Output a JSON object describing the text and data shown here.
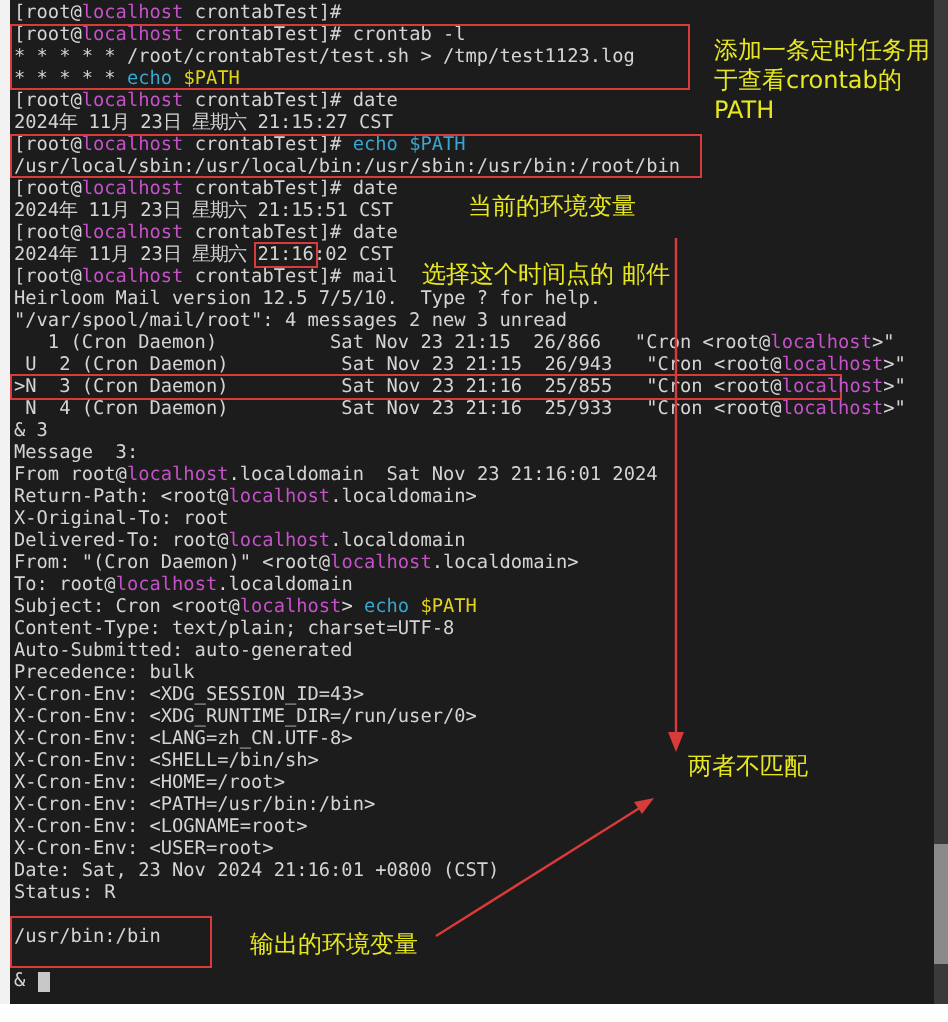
{
  "terminal": {
    "lines": [
      {
        "kind": "text",
        "segments": [
          {
            "text": "[root@",
            "kind": "plain"
          },
          {
            "text": "localhost",
            "kind": "host"
          },
          {
            "text": " crontabTest]#",
            "kind": "plain"
          }
        ]
      },
      {
        "kind": "text",
        "segments": [
          {
            "text": "[root@",
            "kind": "plain"
          },
          {
            "text": "localhost",
            "kind": "host"
          },
          {
            "text": " crontabTest]# crontab -l",
            "kind": "plain"
          }
        ]
      },
      {
        "kind": "text",
        "segments": [
          {
            "text": "* * * * * /root/crontabTest/test.sh > /tmp/test1123.log",
            "kind": "plain"
          }
        ]
      },
      {
        "kind": "text",
        "segments": [
          {
            "text": "* * * * * ",
            "kind": "plain"
          },
          {
            "text": "echo ",
            "kind": "cmd"
          },
          {
            "text": "$PATH",
            "kind": "var"
          }
        ]
      },
      {
        "kind": "text",
        "segments": [
          {
            "text": "[root@",
            "kind": "plain"
          },
          {
            "text": "localhost",
            "kind": "host"
          },
          {
            "text": " crontabTest]# date",
            "kind": "plain"
          }
        ]
      },
      {
        "kind": "text",
        "segments": [
          {
            "text": "2024年 11月 23日 星期六 21:15:27 CST",
            "kind": "plain"
          }
        ]
      },
      {
        "kind": "text",
        "segments": [
          {
            "text": "[root@",
            "kind": "plain"
          },
          {
            "text": "localhost",
            "kind": "host"
          },
          {
            "text": " crontabTest]# ",
            "kind": "plain"
          },
          {
            "text": "echo ",
            "kind": "cmd"
          },
          {
            "text": "$PATH",
            "kind": "cmd"
          }
        ]
      },
      {
        "kind": "text",
        "segments": [
          {
            "text": "/usr/local/sbin:/usr/local/bin:/usr/sbin:/usr/bin:/root/bin",
            "kind": "plain"
          }
        ]
      },
      {
        "kind": "text",
        "segments": [
          {
            "text": "[root@",
            "kind": "plain"
          },
          {
            "text": "localhost",
            "kind": "host"
          },
          {
            "text": " crontabTest]# date",
            "kind": "plain"
          }
        ]
      },
      {
        "kind": "text",
        "segments": [
          {
            "text": "2024年 11月 23日 星期六 21:15:51 CST",
            "kind": "plain"
          }
        ]
      },
      {
        "kind": "text",
        "segments": [
          {
            "text": "[root@",
            "kind": "plain"
          },
          {
            "text": "localhost",
            "kind": "host"
          },
          {
            "text": " crontabTest]# date",
            "kind": "plain"
          }
        ]
      },
      {
        "kind": "text",
        "segments": [
          {
            "text": "2024年 11月 23日 星期六 ",
            "kind": "plain"
          },
          {
            "text": "21:16",
            "kind": "plain"
          },
          {
            "text": ":02 CST",
            "kind": "plain"
          }
        ]
      },
      {
        "kind": "text",
        "segments": [
          {
            "text": "[root@",
            "kind": "plain"
          },
          {
            "text": "localhost",
            "kind": "host"
          },
          {
            "text": " crontabTest]# mail",
            "kind": "plain"
          }
        ]
      },
      {
        "kind": "text",
        "segments": [
          {
            "text": "Heirloom Mail version 12.5 7/5/10.  Type ? for help.",
            "kind": "plain"
          }
        ]
      },
      {
        "kind": "text",
        "segments": [
          {
            "text": "\"/var/spool/mail/root\": 4 messages 2 new 3 unread",
            "kind": "plain"
          }
        ]
      },
      {
        "kind": "text",
        "segments": [
          {
            "text": "   1 (Cron Daemon)          Sat Nov 23 21:15  26/866   \"Cron <root@",
            "kind": "plain"
          },
          {
            "text": "localhost",
            "kind": "host"
          },
          {
            "text": ">\"",
            "kind": "plain"
          }
        ]
      },
      {
        "kind": "text",
        "segments": [
          {
            "text": " U  2 (Cron Daemon)          Sat Nov 23 21:15  26/943   \"Cron <root@",
            "kind": "plain"
          },
          {
            "text": "localhost",
            "kind": "host"
          },
          {
            "text": ">\"",
            "kind": "plain"
          }
        ]
      },
      {
        "kind": "text",
        "segments": [
          {
            "text": ">N  3 (Cron Daemon)          Sat Nov 23 21:16  25/855   \"Cron <root@",
            "kind": "plain"
          },
          {
            "text": "local",
            "kind": "host"
          },
          {
            "text": "host",
            "kind": "host"
          },
          {
            "text": ">\"",
            "kind": "plain"
          }
        ]
      },
      {
        "kind": "text",
        "segments": [
          {
            "text": " N  4 (Cron Daemon)          Sat Nov 23 21:16  25/933   \"Cron <root@",
            "kind": "plain"
          },
          {
            "text": "localhost",
            "kind": "host"
          },
          {
            "text": ">\"",
            "kind": "plain"
          }
        ]
      },
      {
        "kind": "text",
        "segments": [
          {
            "text": "& 3",
            "kind": "plain"
          }
        ]
      },
      {
        "kind": "text",
        "segments": [
          {
            "text": "Message  3:",
            "kind": "plain"
          }
        ]
      },
      {
        "kind": "text",
        "segments": [
          {
            "text": "From root@",
            "kind": "plain"
          },
          {
            "text": "localhost",
            "kind": "host"
          },
          {
            "text": ".localdomain  Sat Nov 23 21:16:01 2024",
            "kind": "plain"
          }
        ]
      },
      {
        "kind": "text",
        "segments": [
          {
            "text": "Return-Path: <root@",
            "kind": "plain"
          },
          {
            "text": "localhost",
            "kind": "host"
          },
          {
            "text": ".localdomain>",
            "kind": "plain"
          }
        ]
      },
      {
        "kind": "text",
        "segments": [
          {
            "text": "X-Original-To: root",
            "kind": "plain"
          }
        ]
      },
      {
        "kind": "text",
        "segments": [
          {
            "text": "Delivered-To: root@",
            "kind": "plain"
          },
          {
            "text": "localhost",
            "kind": "host"
          },
          {
            "text": ".localdomain",
            "kind": "plain"
          }
        ]
      },
      {
        "kind": "text",
        "segments": [
          {
            "text": "From: \"(Cron Daemon)\" <root@",
            "kind": "plain"
          },
          {
            "text": "localhost",
            "kind": "host"
          },
          {
            "text": ".localdomain>",
            "kind": "plain"
          }
        ]
      },
      {
        "kind": "text",
        "segments": [
          {
            "text": "To: root@",
            "kind": "plain"
          },
          {
            "text": "localhost",
            "kind": "host"
          },
          {
            "text": ".localdomain",
            "kind": "plain"
          }
        ]
      },
      {
        "kind": "text",
        "segments": [
          {
            "text": "Subject: Cron <root@",
            "kind": "plain"
          },
          {
            "text": "localhost",
            "kind": "host"
          },
          {
            "text": "> ",
            "kind": "plain"
          },
          {
            "text": "echo ",
            "kind": "cmd"
          },
          {
            "text": "$PATH",
            "kind": "var"
          }
        ]
      },
      {
        "kind": "text",
        "segments": [
          {
            "text": "Content-Type: text/plain; charset=UTF-8",
            "kind": "plain"
          }
        ]
      },
      {
        "kind": "text",
        "segments": [
          {
            "text": "Auto-Submitted: auto-generated",
            "kind": "plain"
          }
        ]
      },
      {
        "kind": "text",
        "segments": [
          {
            "text": "Precedence: bulk",
            "kind": "plain"
          }
        ]
      },
      {
        "kind": "text",
        "segments": [
          {
            "text": "X-Cron-Env: <XDG_SESSION_ID=43>",
            "kind": "plain"
          }
        ]
      },
      {
        "kind": "text",
        "segments": [
          {
            "text": "X-Cron-Env: <XDG_RUNTIME_DIR=/run/user/0>",
            "kind": "plain"
          }
        ]
      },
      {
        "kind": "text",
        "segments": [
          {
            "text": "X-Cron-Env: <LANG=zh_CN.UTF-8>",
            "kind": "plain"
          }
        ]
      },
      {
        "kind": "text",
        "segments": [
          {
            "text": "X-Cron-Env: <SHELL=/bin/sh>",
            "kind": "plain"
          }
        ]
      },
      {
        "kind": "text",
        "segments": [
          {
            "text": "X-Cron-Env: <HOME=/root>",
            "kind": "plain"
          }
        ]
      },
      {
        "kind": "text",
        "segments": [
          {
            "text": "X-Cron-Env: <PATH=/usr/bin:/bin>",
            "kind": "plain"
          }
        ]
      },
      {
        "kind": "text",
        "segments": [
          {
            "text": "X-Cron-Env: <LOGNAME=root>",
            "kind": "plain"
          }
        ]
      },
      {
        "kind": "text",
        "segments": [
          {
            "text": "X-Cron-Env: <USER=root>",
            "kind": "plain"
          }
        ]
      },
      {
        "kind": "text",
        "segments": [
          {
            "text": "Date: Sat, 23 Nov 2024 21:16:01 +0800 (CST)",
            "kind": "plain"
          }
        ]
      },
      {
        "kind": "text",
        "segments": [
          {
            "text": "Status: R",
            "kind": "plain"
          }
        ]
      },
      {
        "kind": "blank"
      },
      {
        "kind": "text",
        "segments": [
          {
            "text": "/usr/bin:/bin",
            "kind": "plain"
          }
        ]
      },
      {
        "kind": "blank"
      }
    ],
    "input_line": {
      "text": "&",
      "cursor": true
    }
  },
  "annotations": [
    {
      "text": "添加一条定时任务用于查看crontab的PATH"
    },
    {
      "text": "当前的环境变量"
    },
    {
      "text": "选择这个时间点的 邮件"
    },
    {
      "text": "两者不匹配"
    },
    {
      "text": "输出的环境变量"
    }
  ]
}
